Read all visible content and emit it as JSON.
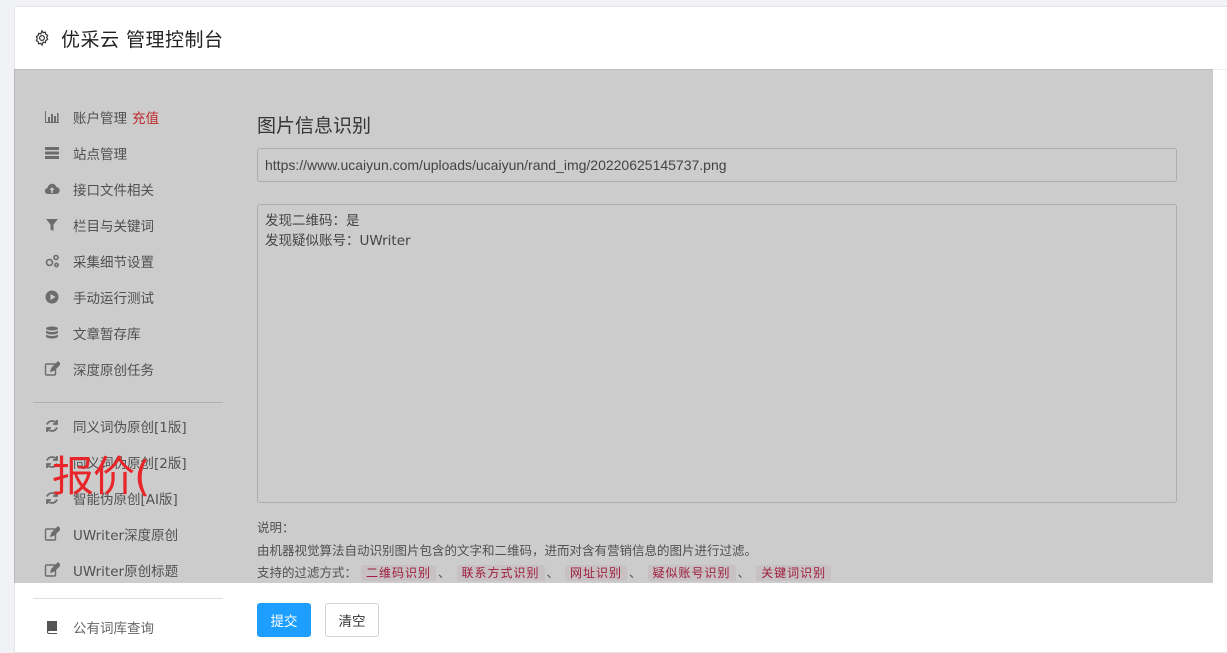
{
  "header": {
    "title": "优采云 管理控制台",
    "icon": "gear-icon"
  },
  "sidebar": {
    "group1": [
      {
        "label": "账户管理",
        "badge": "充值",
        "icon": "bar-chart-icon"
      },
      {
        "label": "站点管理",
        "icon": "server-icon"
      },
      {
        "label": "接口文件相关",
        "icon": "cloud-upload-icon"
      },
      {
        "label": "栏目与关键词",
        "icon": "filter-icon"
      },
      {
        "label": "采集细节设置",
        "icon": "gears-icon"
      },
      {
        "label": "手动运行测试",
        "icon": "play-circle-icon"
      },
      {
        "label": "文章暂存库",
        "icon": "database-icon"
      },
      {
        "label": "深度原创任务",
        "icon": "edit-icon"
      }
    ],
    "group2": [
      {
        "label": "同义词伪原创[1版]",
        "icon": "refresh-icon"
      },
      {
        "label": "同义词伪原创[2版]",
        "icon": "refresh-icon"
      },
      {
        "label": "智能伪原创[AI版]",
        "icon": "refresh-icon"
      },
      {
        "label": "UWriter深度原创",
        "icon": "edit-icon"
      },
      {
        "label": "UWriter原创标题",
        "icon": "edit-icon"
      }
    ],
    "group3": [
      {
        "label": "公有词库查询",
        "icon": "book-icon"
      }
    ]
  },
  "main": {
    "title": "图片信息识别",
    "url_value": "https://www.ucaiyun.com/uploads/ucaiyun/rand_img/20220625145737.png",
    "result_text": "发现二维码：是\n发现疑似账号：UWriter",
    "notes": {
      "heading": "说明：",
      "description": "由机器视觉算法自动识别图片包含的文字和二维码，进而对含有营销信息的图片进行过滤。",
      "methods_label": "支持的过滤方式：",
      "methods": [
        "二维码识别",
        "联系方式识别",
        "网址识别",
        "疑似账号识别",
        "关键词识别"
      ],
      "separator": "、"
    },
    "submit_label": "提交",
    "clear_label": "清空"
  },
  "watermark": "报价(",
  "colors": {
    "primary": "#1e9fff",
    "charge": "#e33333",
    "tag": "#c7254e",
    "watermark": "#e8262a"
  }
}
